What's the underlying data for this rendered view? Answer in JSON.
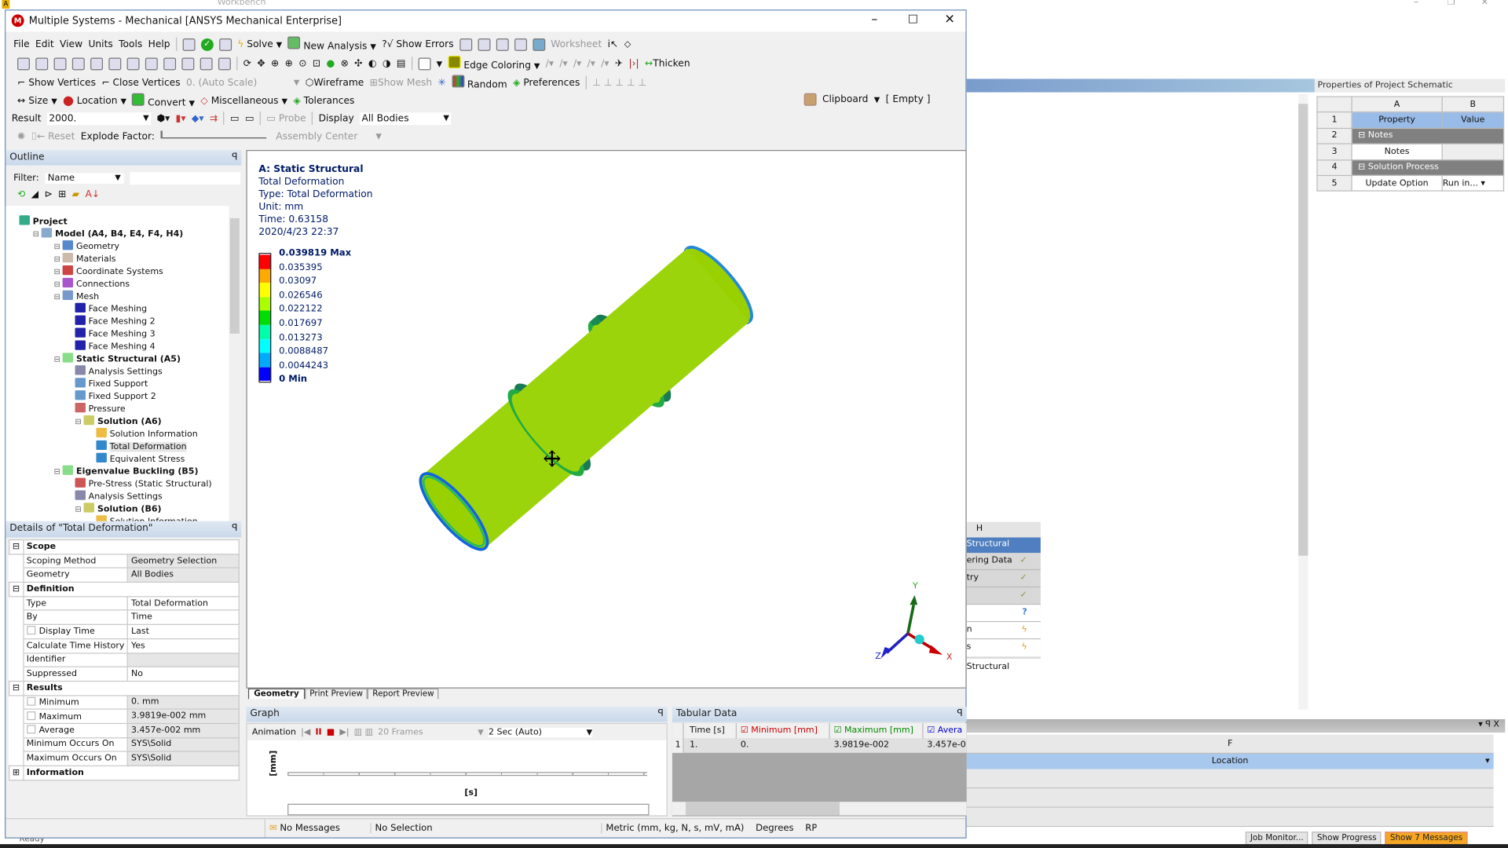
{
  "window": {
    "title": "Multiple Systems - Mechanical [ANSYS Mechanical Enterprise]",
    "bg_title": "Workbench"
  },
  "menu": [
    "File",
    "Edit",
    "View",
    "Units",
    "Tools",
    "Help"
  ],
  "toolbar1": {
    "solve": "Solve",
    "new_analysis": "New Analysis",
    "show_errors": "?√ Show Errors",
    "worksheet": "Worksheet"
  },
  "toolbar2": {
    "edge_coloring": "Edge Coloring",
    "thicken": "Thicken"
  },
  "toolbar3": {
    "show_vertices": "Show Vertices",
    "close_vertices": "Close Vertices",
    "scale": "0. (Auto Scale)",
    "wireframe": "Wireframe",
    "show_mesh": "Show Mesh",
    "random": "Random",
    "preferences": "Preferences"
  },
  "toolbar4": {
    "size": "Size",
    "location": "Location",
    "convert": "Convert",
    "misc": "Miscellaneous",
    "tolerances": "Tolerances",
    "clipboard": "Clipboard",
    "clipboard_state": "[ Empty ]"
  },
  "toolbar5": {
    "result_label": "Result",
    "result_value": "2000.",
    "probe": "Probe",
    "display_label": "Display",
    "display_value": "All Bodies"
  },
  "toolbar6": {
    "reset": "Reset",
    "explode": "Explode Factor:",
    "center": "Assembly Center"
  },
  "outline": {
    "title": "Outline",
    "filter_label": "Filter:",
    "filter_value": "Name",
    "items": [
      {
        "label": "Project",
        "level": 0,
        "bold": true,
        "icon": "project-icon"
      },
      {
        "label": "Model (A4, B4, E4, F4, H4)",
        "level": 1,
        "bold": true,
        "icon": "model-icon"
      },
      {
        "label": "Geometry",
        "level": 2,
        "icon": "geometry-icon"
      },
      {
        "label": "Materials",
        "level": 2,
        "icon": "materials-icon"
      },
      {
        "label": "Coordinate Systems",
        "level": 2,
        "icon": "coordinate-icon"
      },
      {
        "label": "Connections",
        "level": 2,
        "icon": "connections-icon"
      },
      {
        "label": "Mesh",
        "level": 2,
        "icon": "mesh-icon"
      },
      {
        "label": "Face Meshing",
        "level": 3,
        "icon": "face-meshing-icon"
      },
      {
        "label": "Face Meshing 2",
        "level": 3,
        "icon": "face-meshing-icon"
      },
      {
        "label": "Face Meshing 3",
        "level": 3,
        "icon": "face-meshing-icon"
      },
      {
        "label": "Face Meshing 4",
        "level": 3,
        "icon": "face-meshing-icon"
      },
      {
        "label": "Static Structural (A5)",
        "level": 2,
        "bold": true,
        "icon": "static-structural-icon"
      },
      {
        "label": "Analysis Settings",
        "level": 3,
        "icon": "analysis-settings-icon"
      },
      {
        "label": "Fixed Support",
        "level": 3,
        "icon": "fixed-support-icon"
      },
      {
        "label": "Fixed Support 2",
        "level": 3,
        "icon": "fixed-support-icon"
      },
      {
        "label": "Pressure",
        "level": 3,
        "icon": "pressure-icon"
      },
      {
        "label": "Solution (A6)",
        "level": 3,
        "bold": true,
        "icon": "solution-icon"
      },
      {
        "label": "Solution Information",
        "level": 4,
        "icon": "solution-info-icon"
      },
      {
        "label": "Total Deformation",
        "level": 4,
        "selected": true,
        "icon": "result-icon"
      },
      {
        "label": "Equivalent Stress",
        "level": 4,
        "icon": "result-icon"
      },
      {
        "label": "Eigenvalue Buckling (B5)",
        "level": 2,
        "bold": true,
        "icon": "buckling-icon"
      },
      {
        "label": "Pre-Stress (Static Structural)",
        "level": 3,
        "icon": "prestress-icon"
      },
      {
        "label": "Analysis Settings",
        "level": 3,
        "icon": "analysis-settings-icon"
      },
      {
        "label": "Solution (B6)",
        "level": 3,
        "bold": true,
        "icon": "solution-icon"
      },
      {
        "label": "Solution Information",
        "level": 4,
        "icon": "solution-info-icon"
      }
    ]
  },
  "details": {
    "title": "Details of \"Total Deformation\"",
    "rows": [
      {
        "group": "Scope"
      },
      {
        "k": "Scoping Method",
        "v": "Geometry Selection",
        "shaded": true
      },
      {
        "k": "Geometry",
        "v": "All Bodies",
        "shaded": true
      },
      {
        "group": "Definition"
      },
      {
        "k": "Type",
        "v": "Total Deformation"
      },
      {
        "k": "By",
        "v": "Time"
      },
      {
        "k": "Display Time",
        "v": "Last",
        "check": true
      },
      {
        "k": "Calculate Time History",
        "v": "Yes"
      },
      {
        "k": "Identifier",
        "v": "",
        "shaded": true
      },
      {
        "k": "Suppressed",
        "v": "No"
      },
      {
        "group": "Results"
      },
      {
        "k": "Minimum",
        "v": "0. mm",
        "check": true,
        "shaded": true
      },
      {
        "k": "Maximum",
        "v": "3.9819e-002 mm",
        "check": true,
        "shaded": true
      },
      {
        "k": "Average",
        "v": "3.457e-002 mm",
        "check": true,
        "shaded": true
      },
      {
        "k": "Minimum Occurs On",
        "v": "SYS\\Solid",
        "shaded": true
      },
      {
        "k": "Maximum Occurs On",
        "v": "SYS\\Solid",
        "shaded": true
      },
      {
        "group": "Information",
        "collapsed": true
      }
    ]
  },
  "viewport": {
    "header": [
      "A: Static Structural",
      "Total Deformation",
      "Type: Total Deformation",
      "Unit: mm",
      "Time: 0.63158",
      "2020/4/23 22:37"
    ],
    "legend": {
      "labels": [
        "0.039819 Max",
        "0.035395",
        "0.03097",
        "0.026546",
        "0.022122",
        "0.017697",
        "0.013273",
        "0.0088487",
        "0.0044243",
        "0 Min"
      ],
      "colors": [
        "#ff0000",
        "#ffaa00",
        "#ffff00",
        "#aaff00",
        "#00dd00",
        "#00ffaa",
        "#00ffff",
        "#00aaff",
        "#0000ff"
      ]
    },
    "axes": {
      "x": "X",
      "y": "Y",
      "z": "Z"
    },
    "tabs": [
      "Geometry",
      "Print Preview",
      "Report Preview"
    ]
  },
  "graph": {
    "title": "Graph",
    "animation": "Animation",
    "frames": "20 Frames",
    "duration": "2 Sec (Auto)",
    "ylabel": "[mm]",
    "xlabel": "[s]"
  },
  "tabular": {
    "title": "Tabular Data",
    "columns": [
      "Time [s]",
      "Minimum [mm]",
      "Maximum [mm]",
      "Avera"
    ],
    "rows": [
      [
        "1",
        "1.",
        "0.",
        "3.9819e-002",
        "3.457e-0"
      ]
    ]
  },
  "status": {
    "messages": "No Messages",
    "selection": "No Selection",
    "units": "Metric (mm, kg, N, s, mV, mA)",
    "angle": "Degrees",
    "rpm": "RPM"
  },
  "workbench": {
    "props_title": "Properties of Project Schematic",
    "props_cols": [
      "A",
      "B"
    ],
    "props_rows": [
      [
        "1",
        "Property",
        "Value"
      ],
      [
        "2",
        "Notes",
        ""
      ],
      [
        "3",
        "Notes",
        ""
      ],
      [
        "4",
        "Solution Process",
        ""
      ],
      [
        "5",
        "Update Option",
        "Run in..."
      ]
    ],
    "schematic": {
      "col": "H",
      "title": "Structural",
      "cells": [
        "ering Data",
        "try",
        "",
        "",
        "n",
        "s"
      ],
      "footer": "Structural"
    },
    "lower": {
      "col": "F",
      "selected": "Location"
    },
    "buttons": [
      "Job Monitor...",
      "Show Progress",
      "Show 7 Messages"
    ],
    "ready": "Ready"
  }
}
